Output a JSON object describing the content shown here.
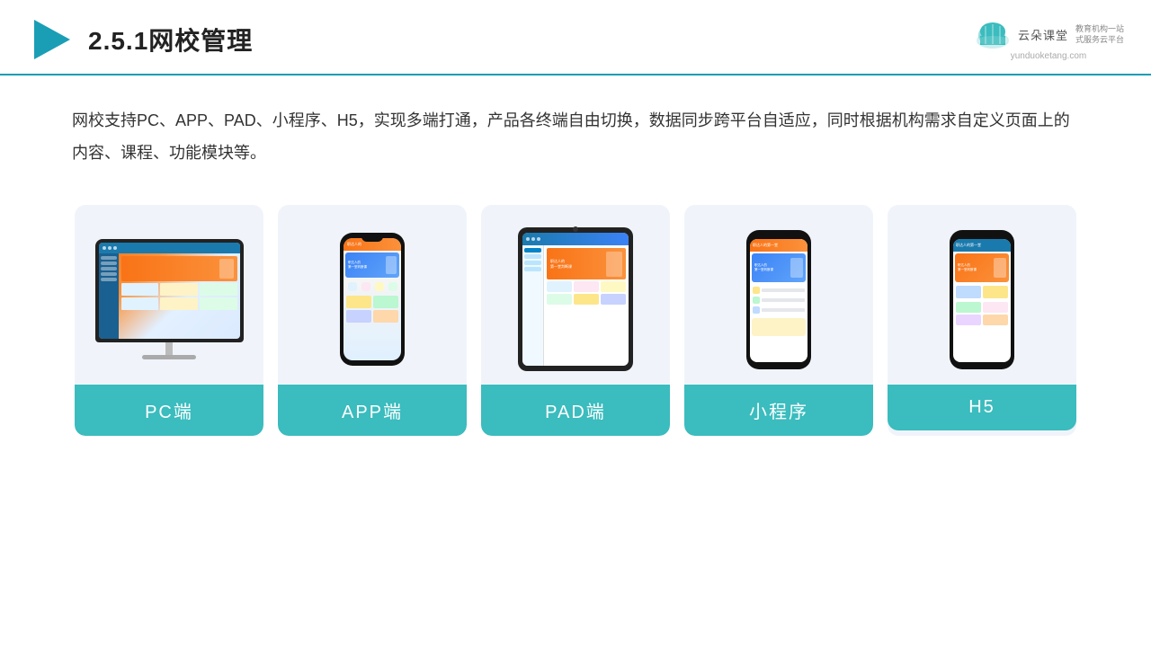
{
  "header": {
    "title": "2.5.1网校管理",
    "logo_main": "云朵课堂",
    "logo_url": "yunduoketang.com",
    "logo_sub": "教育机构一站\n式服务云平台"
  },
  "description": {
    "text": "网校支持PC、APP、PAD、小程序、H5，实现多端打通，产品各终端自由切换，数据同步跨平台自适应，同时根据机构需求自定义页面上的内容、课程、功能模块等。"
  },
  "cards": [
    {
      "id": "pc",
      "label": "PC端"
    },
    {
      "id": "app",
      "label": "APP端"
    },
    {
      "id": "pad",
      "label": "PAD端"
    },
    {
      "id": "miniapp",
      "label": "小程序"
    },
    {
      "id": "h5",
      "label": "H5"
    }
  ],
  "colors": {
    "accent": "#3bbcbe",
    "header_border": "#1a9eb5",
    "title_color": "#222222",
    "text_color": "#333333",
    "card_bg": "#f0f4fa"
  }
}
